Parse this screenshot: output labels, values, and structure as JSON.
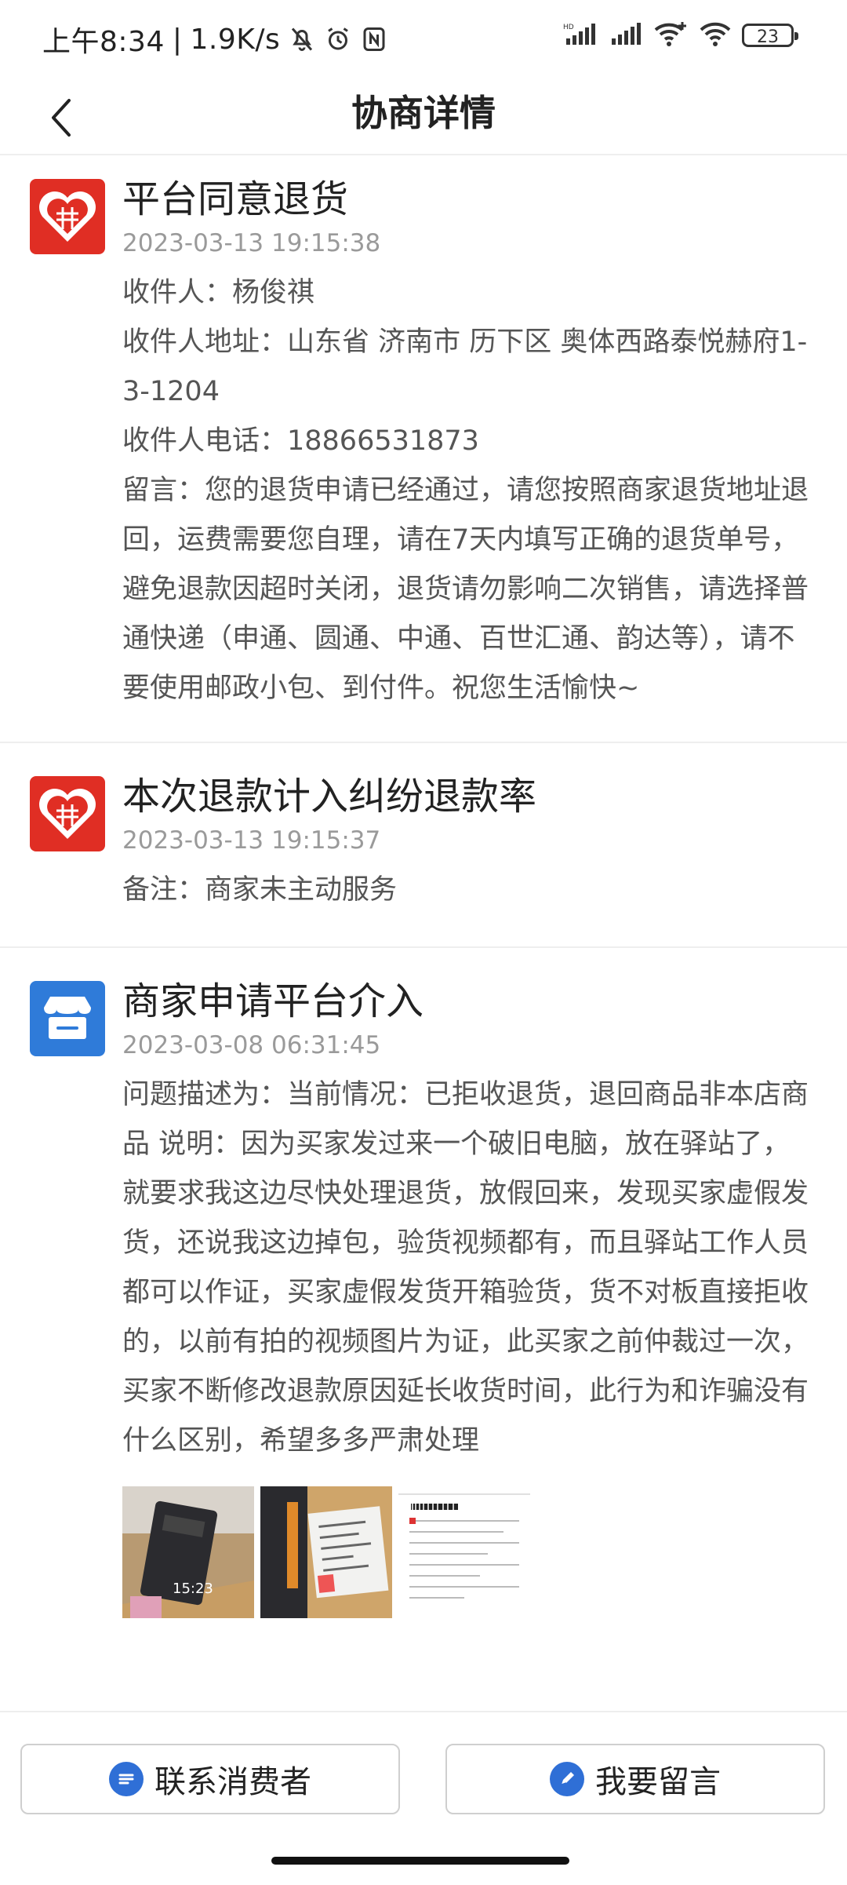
{
  "status_bar": {
    "time": "上午8:34",
    "network_speed": "1.9K/s",
    "battery": "23",
    "icons": [
      "mute-icon",
      "alarm-icon",
      "nfc-icon",
      "hd-signal-icon",
      "signal-icon",
      "wifi-plus-icon",
      "wifi-icon",
      "battery-icon"
    ]
  },
  "header": {
    "title": "协商详情",
    "back_icon": "chevron-left-icon"
  },
  "entries": [
    {
      "logo": "pinduoduo-logo",
      "title": "平台同意退货",
      "time": "2023-03-13 19:15:38",
      "lines": [
        "收件人：杨俊祺",
        "收件人地址：山东省 济南市 历下区 奥体西路泰悦赫府1-3-1204",
        "收件人电话：18866531873",
        "留言：您的退货申请已经通过，请您按照商家退货地址退回，运费需要您自理，请在7天内填写正确的退货单号，避免退款因超时关闭，退货请勿影响二次销售，请选择普通快递（申通、圆通、中通、百世汇通、韵达等），请不要使用邮政小包、到付件。祝您生活愉快~"
      ]
    },
    {
      "logo": "pinduoduo-logo",
      "title": "本次退款计入纠纷退款率",
      "time": "2023-03-13 19:15:37",
      "lines": [
        "备注：商家未主动服务"
      ]
    },
    {
      "logo": "merchant-store-logo",
      "title": "商家申请平台介入",
      "time": "2023-03-08 06:31:45",
      "lines": [
        "问题描述为：当前情况：已拒收退货，退回商品非本店商品 说明：因为买家发过来一个破旧电脑，放在驿站了，就要求我这边尽快处理退货，放假回来，发现买家虚假发货，还说我这边掉包，验货视频都有，而且驿站工作人员都可以作证，买家虚假发货开箱验货，货不对板直接拒收的，以前有拍的视频图片为证，此买家之前仲裁过一次，买家不断修改退款原因延长收货时间，此行为和诈骗没有什么区别，希望多多严肃处理"
      ],
      "photos": [
        {
          "name": "laptop-photo-thumbnail",
          "caption": "15:23"
        },
        {
          "name": "package-label-photo-thumbnail",
          "caption": ""
        },
        {
          "name": "receipt-document-thumbnail",
          "caption": ""
        }
      ]
    }
  ],
  "footer": {
    "contact_label": "联系消费者",
    "message_label": "我要留言",
    "contact_icon": "chat-bubble-icon",
    "message_icon": "pencil-icon"
  },
  "colors": {
    "pdd_red": "#e02e24",
    "store_blue": "#2f7bd9",
    "button_icon_blue": "#2f6fd6",
    "timestamp_gray": "#9a9a9a"
  }
}
